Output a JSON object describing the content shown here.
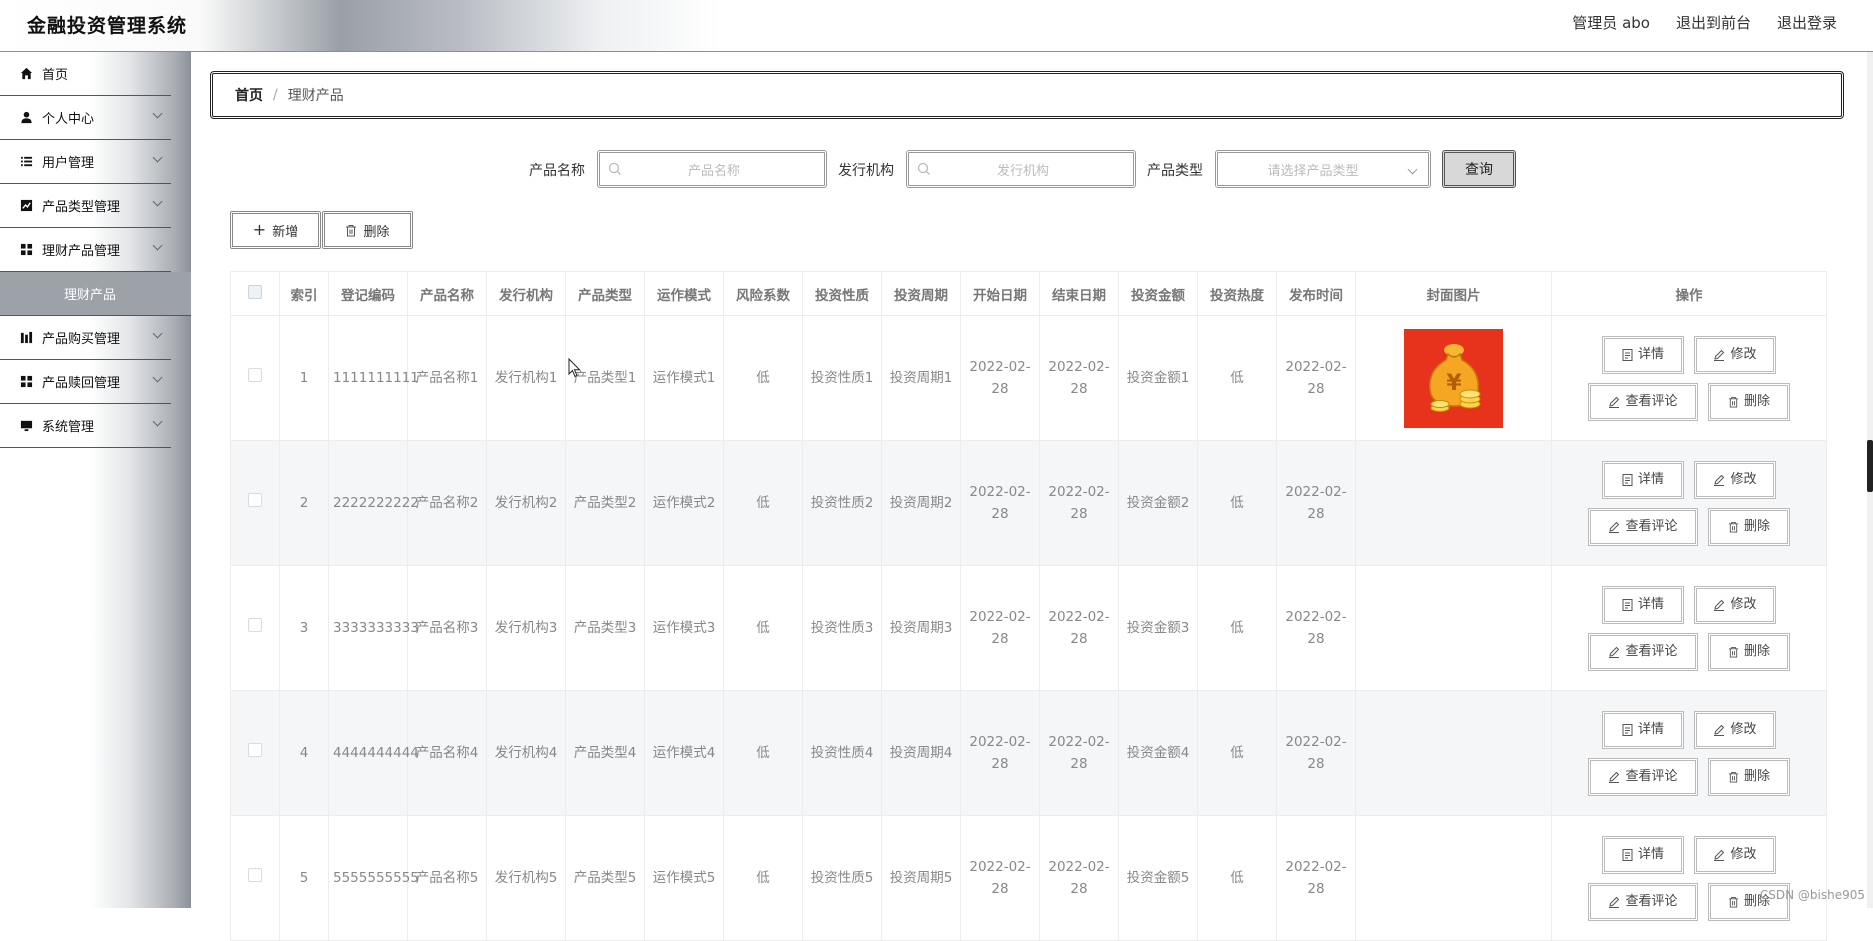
{
  "header": {
    "brand": "金融投资管理系统",
    "user_label": "管理员 abo",
    "back_to_front": "退出到前台",
    "logout": "退出登录"
  },
  "sidebar": {
    "items": [
      {
        "label": "首页",
        "icon": "home-icon",
        "has_children": false
      },
      {
        "label": "个人中心",
        "icon": "user-icon",
        "has_children": true
      },
      {
        "label": "用户管理",
        "icon": "list-icon",
        "has_children": true
      },
      {
        "label": "产品类型管理",
        "icon": "chart-icon",
        "has_children": true
      },
      {
        "label": "理财产品管理",
        "icon": "grid-icon",
        "has_children": true
      },
      {
        "label": "理财产品",
        "icon": "",
        "has_children": false,
        "submenu": true,
        "active": true
      },
      {
        "label": "产品购买管理",
        "icon": "bars-icon",
        "has_children": true
      },
      {
        "label": "产品赎回管理",
        "icon": "grid-icon",
        "has_children": true
      },
      {
        "label": "系统管理",
        "icon": "monitor-icon",
        "has_children": true
      }
    ]
  },
  "breadcrumb": {
    "home": "首页",
    "separator": "/",
    "current": "理财产品"
  },
  "search": {
    "name_label": "产品名称",
    "name_placeholder": "产品名称",
    "org_label": "发行机构",
    "org_placeholder": "发行机构",
    "type_label": "产品类型",
    "type_placeholder": "请选择产品类型",
    "query_button": "查询"
  },
  "toolbar": {
    "add_label": "新增",
    "delete_label": "删除"
  },
  "table": {
    "headers": [
      "",
      "索引",
      "登记编码",
      "产品名称",
      "发行机构",
      "产品类型",
      "运作模式",
      "风险系数",
      "投资性质",
      "投资周期",
      "开始日期",
      "结束日期",
      "投资金额",
      "投资热度",
      "发布时间",
      "封面图片",
      "操作"
    ],
    "rows": [
      {
        "index": "1",
        "code": "1111111111",
        "name": "产品名称1",
        "org": "发行机构1",
        "type": "产品类型1",
        "mode": "运作模式1",
        "risk": "低",
        "nature": "投资性质1",
        "period": "投资周期1",
        "start": "2022-02-28",
        "end": "2022-02-28",
        "amount": "投资金额1",
        "heat": "低",
        "publish": "2022-02-28",
        "has_cover": true
      },
      {
        "index": "2",
        "code": "2222222222",
        "name": "产品名称2",
        "org": "发行机构2",
        "type": "产品类型2",
        "mode": "运作模式2",
        "risk": "低",
        "nature": "投资性质2",
        "period": "投资周期2",
        "start": "2022-02-28",
        "end": "2022-02-28",
        "amount": "投资金额2",
        "heat": "低",
        "publish": "2022-02-28",
        "has_cover": false
      },
      {
        "index": "3",
        "code": "3333333333",
        "name": "产品名称3",
        "org": "发行机构3",
        "type": "产品类型3",
        "mode": "运作模式3",
        "risk": "低",
        "nature": "投资性质3",
        "period": "投资周期3",
        "start": "2022-02-28",
        "end": "2022-02-28",
        "amount": "投资金额3",
        "heat": "低",
        "publish": "2022-02-28",
        "has_cover": false
      },
      {
        "index": "4",
        "code": "4444444444",
        "name": "产品名称4",
        "org": "发行机构4",
        "type": "产品类型4",
        "mode": "运作模式4",
        "risk": "低",
        "nature": "投资性质4",
        "period": "投资周期4",
        "start": "2022-02-28",
        "end": "2022-02-28",
        "amount": "投资金额4",
        "heat": "低",
        "publish": "2022-02-28",
        "has_cover": false
      },
      {
        "index": "5",
        "code": "5555555555",
        "name": "产品名称5",
        "org": "发行机构5",
        "type": "产品类型5",
        "mode": "运作模式5",
        "risk": "低",
        "nature": "投资性质5",
        "period": "投资周期5",
        "start": "2022-02-28",
        "end": "2022-02-28",
        "amount": "投资金额5",
        "heat": "低",
        "publish": "2022-02-28",
        "has_cover": false
      }
    ],
    "ops": {
      "detail": "详情",
      "edit": "修改",
      "comments": "查看评论",
      "delete": "删除"
    }
  },
  "watermark": "CSDN @bishe905"
}
